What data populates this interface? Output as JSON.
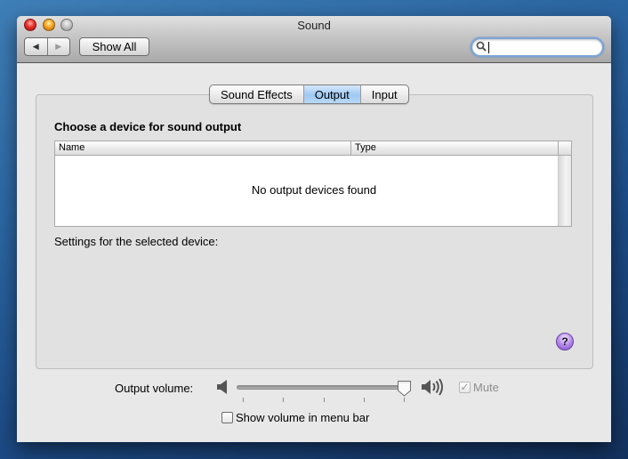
{
  "window": {
    "title": "Sound",
    "controls": [
      "close",
      "minimize",
      "zoom"
    ]
  },
  "toolbar": {
    "back_icon": "◀",
    "forward_icon": "▶",
    "show_all_label": "Show All",
    "search": {
      "value": "",
      "placeholder": "",
      "icon": "search-icon"
    }
  },
  "tabs": [
    {
      "label": "Sound Effects",
      "active": false
    },
    {
      "label": "Output",
      "active": true
    },
    {
      "label": "Input",
      "active": false
    }
  ],
  "output": {
    "heading": "Choose a device for sound output",
    "table": {
      "columns": [
        "Name",
        "Type"
      ],
      "rows": [],
      "empty_message": "No output devices found"
    },
    "settings_label": "Settings for the selected device:",
    "help_label": "?"
  },
  "volume": {
    "label": "Output volume:",
    "level_percent": 100,
    "tick_count": 5,
    "mute_label": "Mute",
    "mute_checked": true,
    "mute_enabled": false,
    "show_in_menubar_label": "Show volume in menu bar",
    "show_in_menubar_checked": false
  }
}
